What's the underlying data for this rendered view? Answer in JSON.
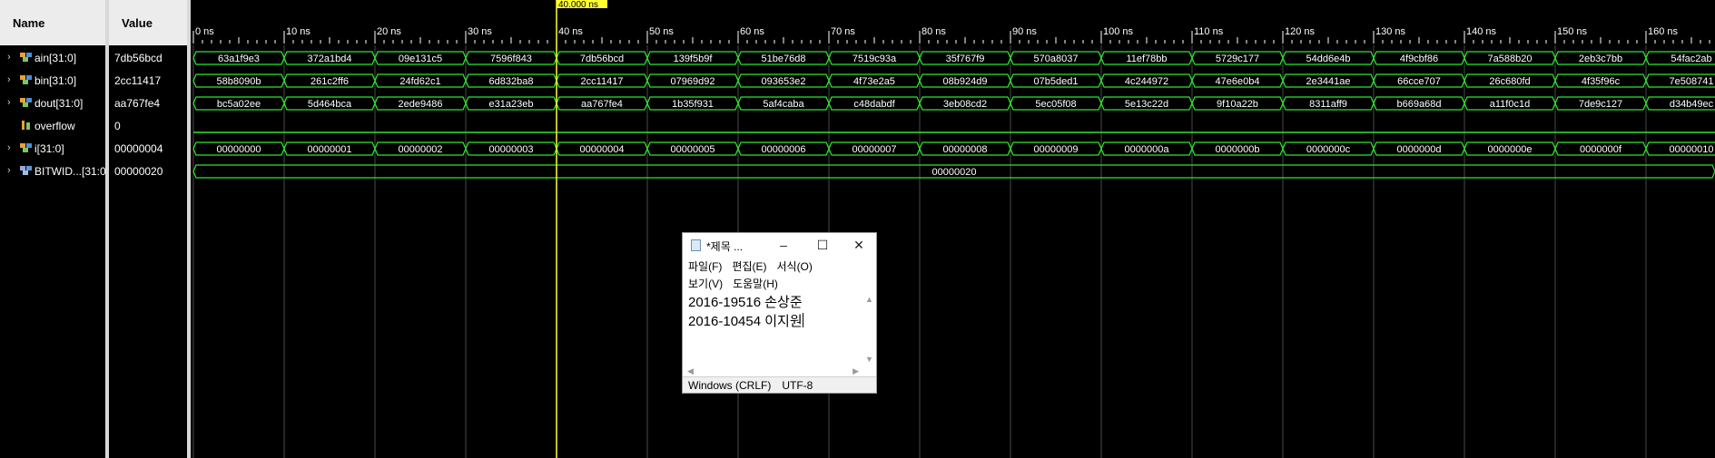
{
  "headers": {
    "name": "Name",
    "value": "Value"
  },
  "signals": [
    {
      "name": "ain[31:0]",
      "value": "7db56bcd",
      "icon": "bus-icon",
      "expandable": true,
      "segments": [
        "63a1f9e3",
        "372a1bd4",
        "09e131c5",
        "7596f843",
        "7db56bcd",
        "139f5b9f",
        "51be76d8",
        "7519c93a",
        "35f767f9",
        "570a8037",
        "11ef78bb",
        "5729c177",
        "54dd6e4b",
        "4f9cbf86",
        "7a588b20",
        "2eb3c7bb",
        "54fac2ab"
      ]
    },
    {
      "name": "bin[31:0]",
      "value": "2cc11417",
      "icon": "bus-icon",
      "expandable": true,
      "segments": [
        "58b8090b",
        "261c2ff6",
        "24fd62c1",
        "6d832ba8",
        "2cc11417",
        "07969d92",
        "093653e2",
        "4f73e2a5",
        "08b924d9",
        "07b5ded1",
        "4c244972",
        "47e6e0b4",
        "2e3441ae",
        "66cce707",
        "26c680fd",
        "4f35f96c",
        "7e508741"
      ]
    },
    {
      "name": "dout[31:0]",
      "value": "aa767fe4",
      "icon": "bus-icon",
      "expandable": true,
      "segments": [
        "bc5a02ee",
        "5d464bca",
        "2ede9486",
        "e31a23eb",
        "aa767fe4",
        "1b35f931",
        "5af4caba",
        "c48dabdf",
        "3eb08cd2",
        "5ec05f08",
        "5e13c22d",
        "9f10a22b",
        "8311aff9",
        "b669a68d",
        "a11f0c1d",
        "7de9c127",
        "d34b49ec"
      ]
    },
    {
      "name": "overflow",
      "value": "0",
      "icon": "bit-icon",
      "expandable": false,
      "segments": []
    },
    {
      "name": "i[31:0]",
      "value": "00000004",
      "icon": "bus-icon",
      "expandable": true,
      "segments": [
        "00000000",
        "00000001",
        "00000002",
        "00000003",
        "00000004",
        "00000005",
        "00000006",
        "00000007",
        "00000008",
        "00000009",
        "0000000a",
        "0000000b",
        "0000000c",
        "0000000d",
        "0000000e",
        "0000000f",
        "00000010"
      ]
    },
    {
      "name": "BITWID...[31:0]",
      "value": "00000020",
      "icon": "param-icon",
      "expandable": true,
      "segments": [
        "00000020"
      ]
    }
  ],
  "timeline": {
    "ticks": [
      "0 ns",
      "10 ns",
      "20 ns",
      "30 ns",
      "40 ns",
      "50 ns",
      "60 ns",
      "70 ns",
      "80 ns",
      "90 ns",
      "100 ns",
      "110 ns",
      "120 ns",
      "130 ns",
      "140 ns",
      "150 ns",
      "160 ns"
    ],
    "cursor_label": "40.000 ns",
    "cursor_ns": 40,
    "ns_per_segment": 10
  },
  "colors": {
    "wave": "#2ee62e",
    "cursor": "#ffff33",
    "grid": "#4a4a4a",
    "text": "#ffffff"
  },
  "notepad": {
    "title": "*제목 ...",
    "menu_row1": [
      "파일(F)",
      "편집(E)",
      "서식(O)"
    ],
    "menu_row2": [
      "보기(V)",
      "도움말(H)"
    ],
    "lines": [
      "2016-19516 손상준",
      "2016-10454 이지원"
    ],
    "status_eol": "Windows (CRLF)",
    "status_enc": "UTF-8",
    "minimize": "–",
    "maximize": "☐",
    "close": "✕"
  }
}
